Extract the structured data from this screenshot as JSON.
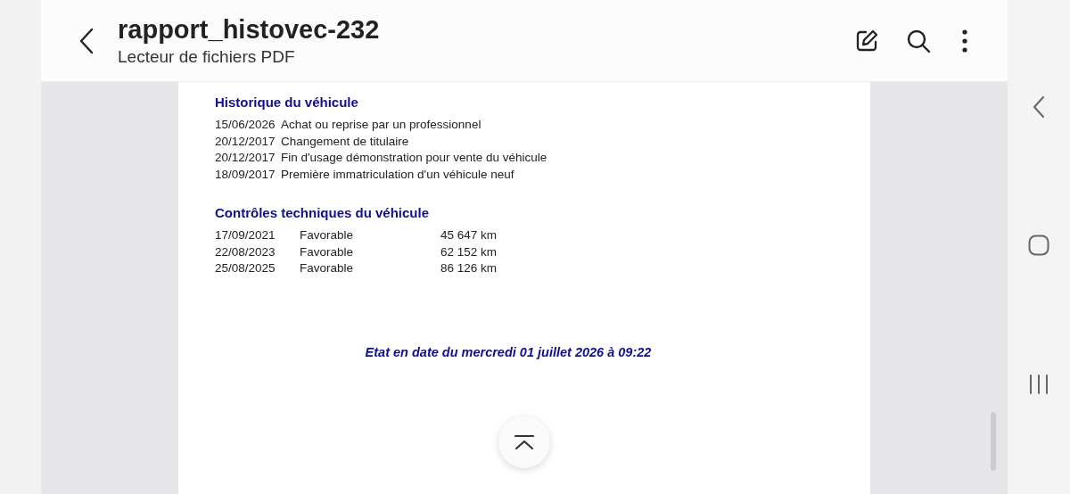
{
  "header": {
    "title": "rapport_histovec-232",
    "subtitle": "Lecteur de fichiers PDF"
  },
  "document": {
    "history": {
      "heading": "Historique du véhicule",
      "rows": [
        {
          "date": "15/06/2026",
          "event": "Achat ou reprise par un professionnel"
        },
        {
          "date": "20/12/2017",
          "event": "Changement de titulaire"
        },
        {
          "date": "20/12/2017",
          "event": "Fin d'usage démonstration pour vente du véhicule"
        },
        {
          "date": "18/09/2017",
          "event": "Première immatriculation d'un véhicule neuf"
        }
      ]
    },
    "inspections": {
      "heading": "Contrôles techniques du véhicule",
      "rows": [
        {
          "date": "17/09/2021",
          "result": "Favorable",
          "mileage": "45 647 km"
        },
        {
          "date": "22/08/2023",
          "result": "Favorable",
          "mileage": "62 152 km"
        },
        {
          "date": "25/08/2025",
          "result": "Favorable",
          "mileage": "86 126 km"
        }
      ]
    },
    "footer": "Etat en date du mercredi 01 juillet 2026 à 09:22"
  }
}
